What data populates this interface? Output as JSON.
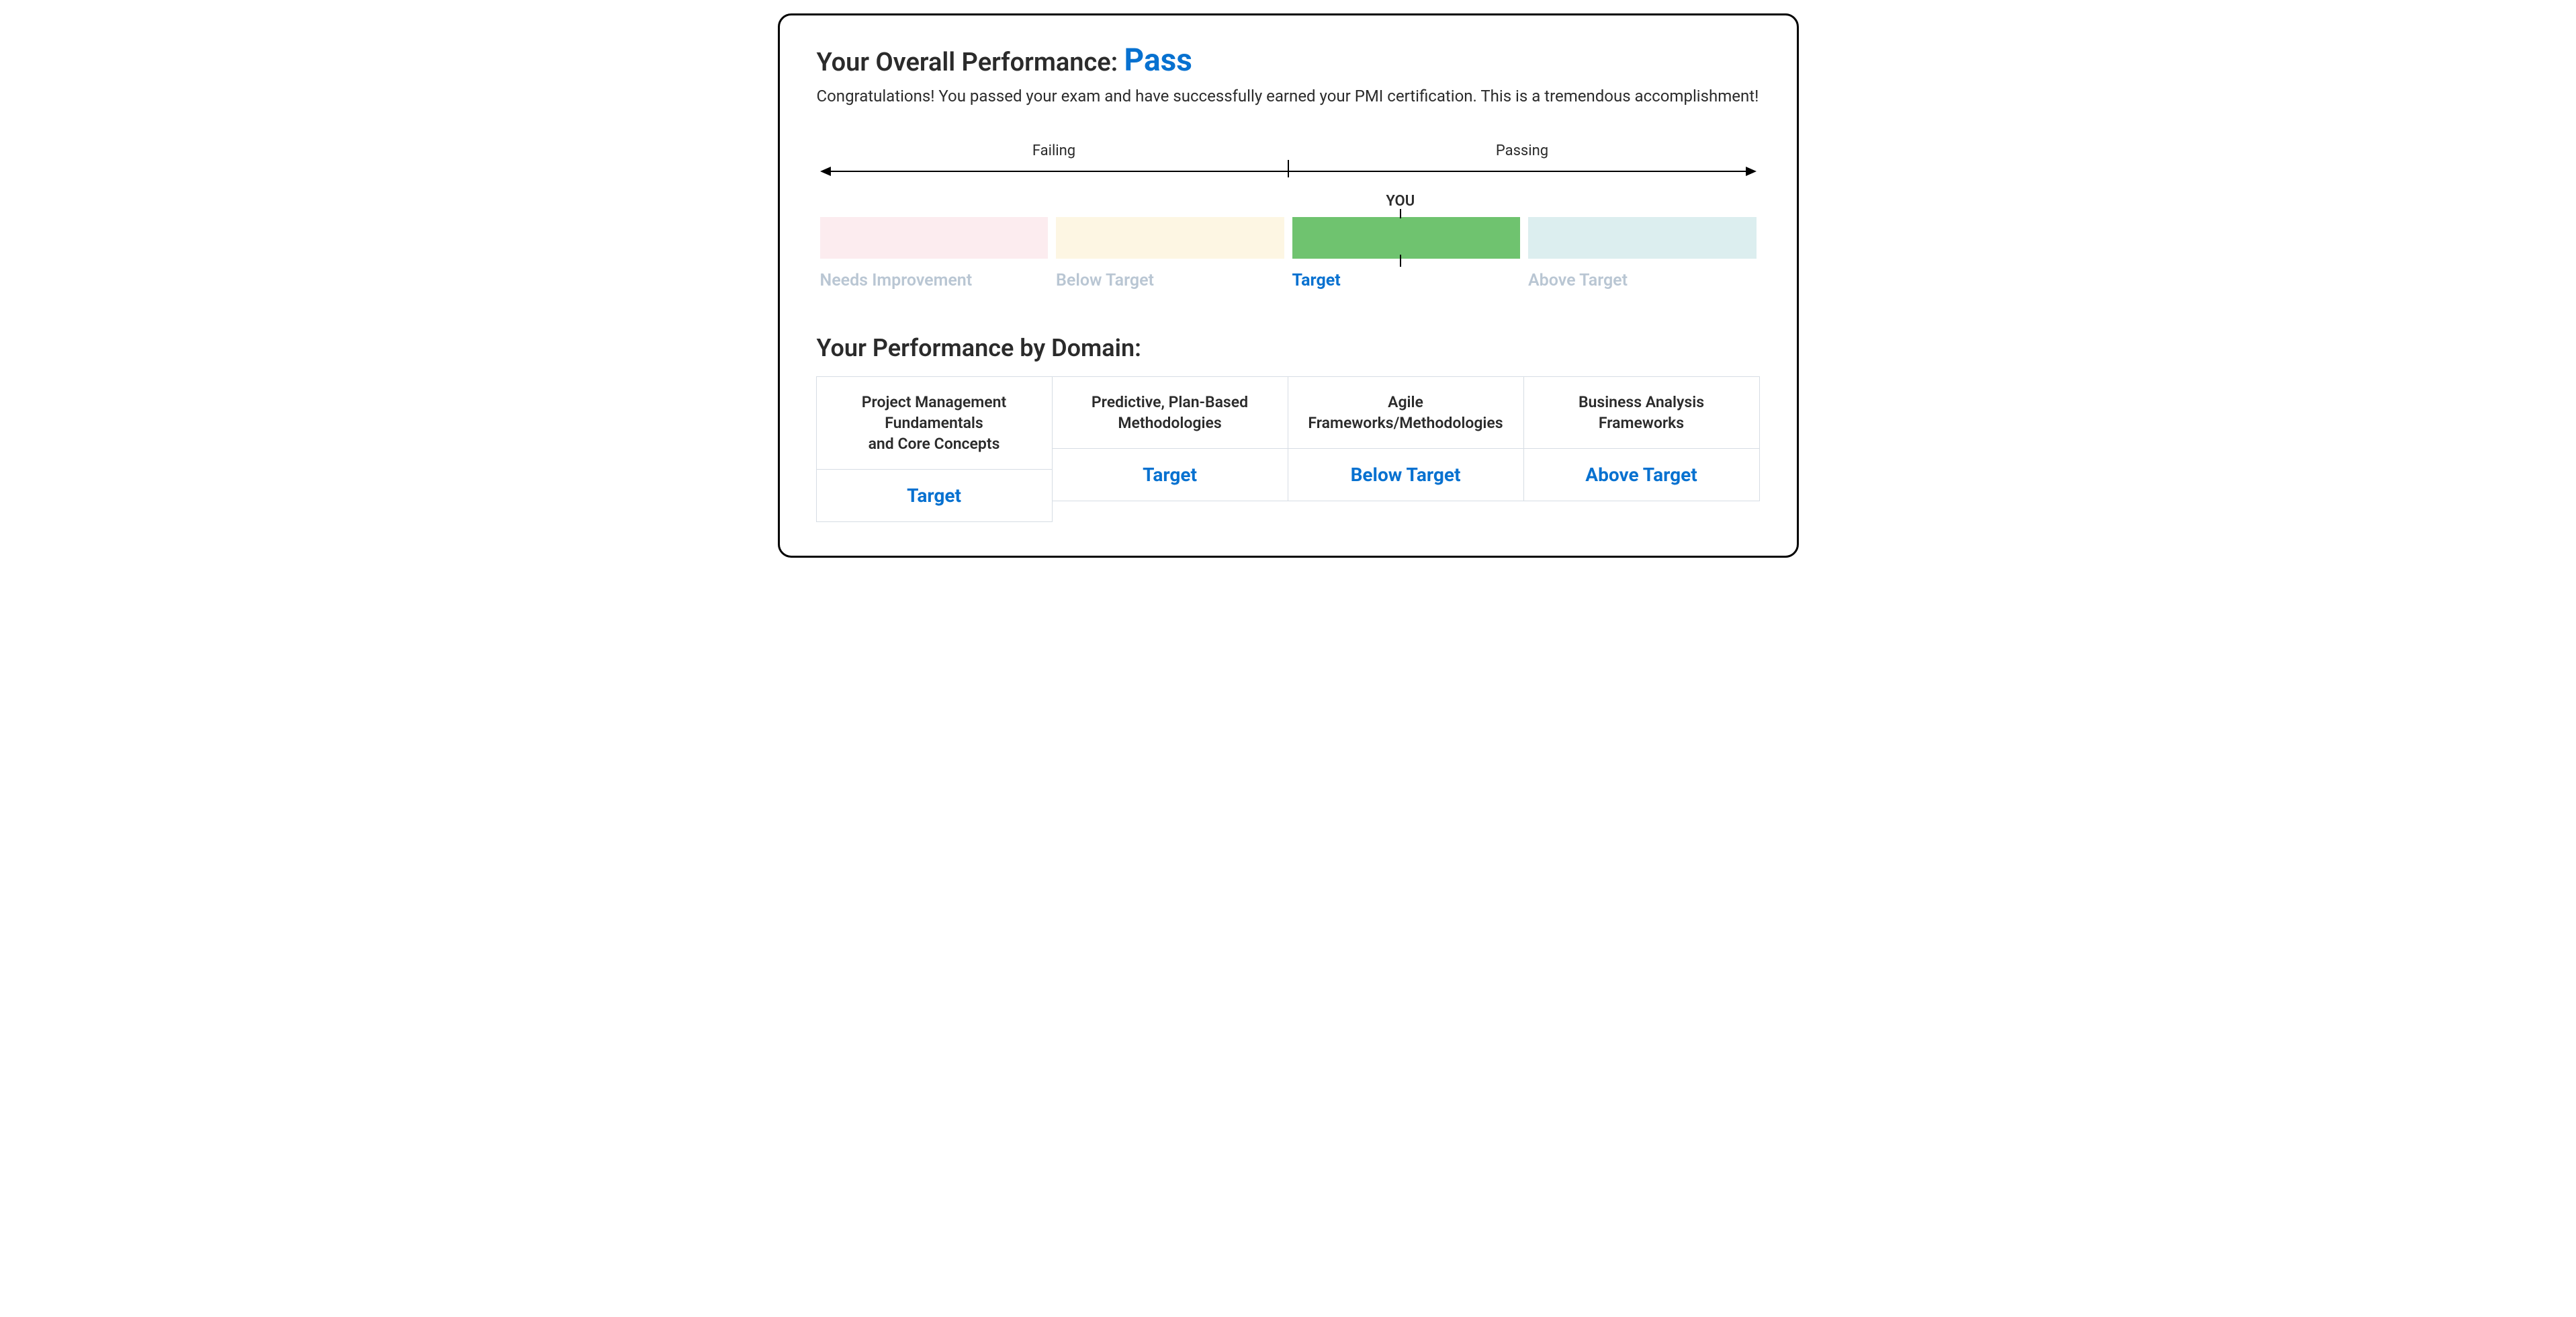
{
  "header": {
    "title_prefix": "Your Overall Performance: ",
    "result": "Pass",
    "congrats": "Congratulations! You passed your exam and have successfully earned your PMI certification. This is a tremendous accomplishment!"
  },
  "scale": {
    "left_label": "Failing",
    "right_label": "Passing",
    "you_label": "YOU",
    "you_position_pct": 62,
    "levels": [
      {
        "label": "Needs Improvement",
        "color": "#fcecef",
        "active": false
      },
      {
        "label": "Below Target",
        "color": "#fdf6e3",
        "active": false
      },
      {
        "label": "Target",
        "color": "#6fc36f",
        "active": true
      },
      {
        "label": "Above Target",
        "color": "#dceeef",
        "active": false
      }
    ]
  },
  "domains": {
    "title": "Your Performance by Domain:",
    "items": [
      {
        "name": "Project Management\nFundamentals\nand Core Concepts",
        "score": "Target"
      },
      {
        "name": "Predictive, Plan-Based\nMethodologies",
        "score": "Target"
      },
      {
        "name": "Agile\nFrameworks/Methodologies",
        "score": "Below Target"
      },
      {
        "name": "Business Analysis\nFrameworks",
        "score": "Above Target"
      }
    ]
  },
  "chart_data": {
    "type": "bar",
    "title": "Your Overall Performance",
    "categories": [
      "Needs Improvement",
      "Below Target",
      "Target",
      "Above Target"
    ],
    "axis_regions": [
      "Failing",
      "Failing",
      "Passing",
      "Passing"
    ],
    "highlighted_category": "Target",
    "marker": {
      "label": "YOU",
      "category": "Target",
      "approx_position_pct": 62
    }
  }
}
